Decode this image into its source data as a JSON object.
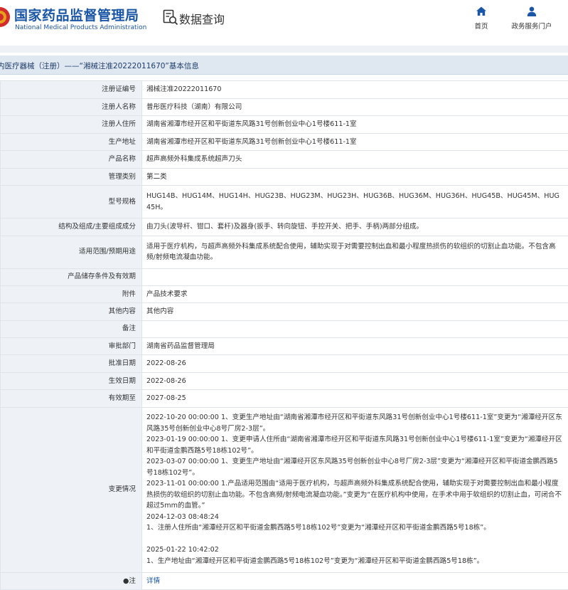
{
  "header": {
    "org_name_cn": "国家药品监督管理局",
    "org_name_en": "National Medical Products Administration",
    "page_title": "数据查询",
    "nav": {
      "home_label": "首页",
      "portal_label": "政务服务门户"
    }
  },
  "breadcrumb": {
    "title": "内医疗器械（注册）——“湘械注准20222011670”基本信息"
  },
  "table": {
    "column_label_header": "",
    "rows": [
      {
        "label": "注册证编号",
        "value": "湘械注准20222011670"
      },
      {
        "label": "注册人名称",
        "value": "普彤医疗科技（湖南）有限公司"
      },
      {
        "label": "注册人住所",
        "value": "湖南省湘潭市经开区和平街道东风路31号创新创业中心1号楼611-1室"
      },
      {
        "label": "生产地址",
        "value": "湖南省湘潭市经开区和平街道东风路31号创新创业中心1号楼611-1室"
      },
      {
        "label": "产品名称",
        "value": "超声高频外科集成系统超声刀头"
      },
      {
        "label": "管理类别",
        "value": "第二类"
      },
      {
        "label": "型号规格",
        "value": "HUG14B、HUG14M、HUG14H、HUG23B、HUG23M、HUG23H、HUG36B、HUG36M、HUG36H、HUG45B、HUG45M、HUG45H。"
      },
      {
        "label": "结构及组成/主要组成成分",
        "value": "由刀头(波导杆、钳口、套杆)及器身(扳手、转向旋钮、手控开关、把手、手柄)两部分组成。"
      },
      {
        "label": "适用范围/预期用途",
        "value": "适用于医疗机构，与超声高频外科集成系统配合使用，辅助实现于对需要控制出血和最小程度热损伤的软组织的切割止血功能。不包含高频/射频电流凝血功能。"
      },
      {
        "label": "产品储存条件及有效期",
        "value": ""
      },
      {
        "label": "附件",
        "value": "产品技术要求"
      },
      {
        "label": "其他内容",
        "value": "其他内容"
      },
      {
        "label": "备注",
        "value": ""
      },
      {
        "label": "审批部门",
        "value": "湖南省药品监督管理局"
      },
      {
        "label": "批准日期",
        "value": "2022-08-26"
      },
      {
        "label": "生效日期",
        "value": "2022-08-26"
      },
      {
        "label": "有效期至",
        "value": "2027-08-25"
      }
    ],
    "changes": {
      "label": "变更情况",
      "lines": [
        "2022-10-20 00:00:00 1、变更生产地址由“湖南省湘潭市经开区和平街道东风路31号创新创业中心1号楼611-1室”变更为“湘潭经开区东风路35号创新创业中心8号厂房2-3层”。",
        "2023-01-19 00:00:00 1、变更申请人住所由“湖南省湘潭市经开区和平街道东风路31号创新创业中心1号楼611-1室”变更为“湘潭经开区和平街道金鹏西路5号18栋102号”。",
        "2023-03-07 00:00:00 1、变更生产地址由“湘潭经开区东风路35号创新创业中心8号厂房2-3层”变更为“湘潭经开区和平街道金鹏西路5号18栋102号”。",
        "2023-11-01 00:00:00 1.产品适用范围由“适用于医疗机构，与超声高频外科集成系统配合使用，辅助实现于对需要控制出血和最小程度热损伤的软组织的切割止血功能。不包含高频/射频电流凝血功能。”变更为“在医疗机构中使用，在手术中用于软组织的切割止血，可闭合不超过5mm的血管。”",
        "2024-12-03 08:48:24",
        "1、注册人住所由“湘潭经开区和平街道金鹏西路5号18栋102号”变更为“湘潭经开区和平街道金鹏西路5号18栋”。",
        "",
        "2025-01-22 10:42:02",
        "1、生产地址由“湘潭经开区和平街道金鹏西路5号18栋102号”变更为“湘潭经开区和平街道金鹏西路5号18栋”。"
      ]
    },
    "note": {
      "label": "●注",
      "link": "详情"
    }
  },
  "colors": {
    "brand_blue": "#1a56a6",
    "label_bg": "#eef2f7",
    "title_bar_bg": "#dfe7f1",
    "emblem_red": "#d42b2b",
    "emblem_gold": "#e3a21a"
  }
}
